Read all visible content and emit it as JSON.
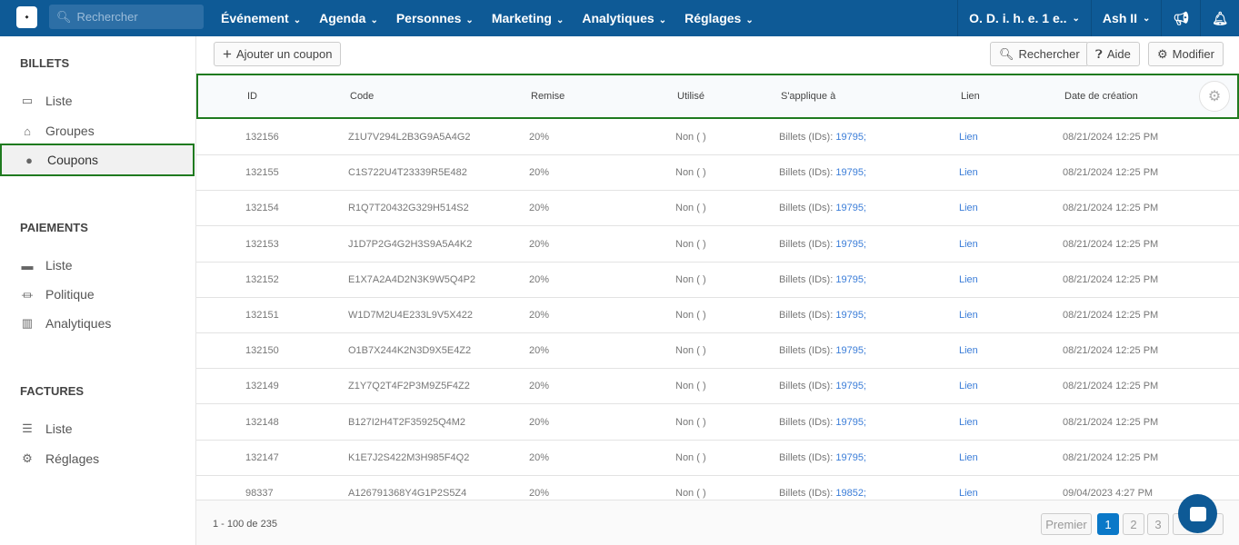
{
  "topbar": {
    "search_placeholder": "Rechercher",
    "nav": [
      "Événement",
      "Agenda",
      "Personnes",
      "Marketing",
      "Analytiques",
      "Réglages"
    ],
    "org": "O. D. i. h. e. 1 e..",
    "user": "Ash II"
  },
  "sidebar": {
    "sections": [
      {
        "title": "BILLETS",
        "items": [
          "Liste",
          "Groupes",
          "Coupons"
        ]
      },
      {
        "title": "PAIEMENTS",
        "items": [
          "Liste",
          "Politique",
          "Analytiques"
        ]
      },
      {
        "title": "FACTURES",
        "items": [
          "Liste",
          "Réglages"
        ]
      }
    ],
    "active": "Coupons"
  },
  "toolbar": {
    "add": "Ajouter un coupon",
    "search": "Rechercher",
    "help": "Aide",
    "edit": "Modifier"
  },
  "table": {
    "headers": [
      "ID",
      "Code",
      "Remise",
      "Utilisé",
      "S'applique à",
      "Lien",
      "Date de création"
    ],
    "rows": [
      [
        "132156",
        "Z1U7V294L2B3G9A5A4G2",
        "20%",
        "Non ( )",
        "Billets (IDs): ",
        "19795;",
        "Lien",
        "08/21/2024 12:25 PM"
      ],
      [
        "132155",
        "C1S722U4T23339R5E482",
        "20%",
        "Non ( )",
        "Billets (IDs): ",
        "19795;",
        "Lien",
        "08/21/2024 12:25 PM"
      ],
      [
        "132154",
        "R1Q7T20432G329H514S2",
        "20%",
        "Non ( )",
        "Billets (IDs): ",
        "19795;",
        "Lien",
        "08/21/2024 12:25 PM"
      ],
      [
        "132153",
        "J1D7P2G4G2H3S9A5A4K2",
        "20%",
        "Non ( )",
        "Billets (IDs): ",
        "19795;",
        "Lien",
        "08/21/2024 12:25 PM"
      ],
      [
        "132152",
        "E1X7A2A4D2N3K9W5Q4P2",
        "20%",
        "Non ( )",
        "Billets (IDs): ",
        "19795;",
        "Lien",
        "08/21/2024 12:25 PM"
      ],
      [
        "132151",
        "W1D7M2U4E233L9V5X422",
        "20%",
        "Non ( )",
        "Billets (IDs): ",
        "19795;",
        "Lien",
        "08/21/2024 12:25 PM"
      ],
      [
        "132150",
        "O1B7X244K2N3D9X5E4Z2",
        "20%",
        "Non ( )",
        "Billets (IDs): ",
        "19795;",
        "Lien",
        "08/21/2024 12:25 PM"
      ],
      [
        "132149",
        "Z1Y7Q2T4F2P3M9Z5F4Z2",
        "20%",
        "Non ( )",
        "Billets (IDs): ",
        "19795;",
        "Lien",
        "08/21/2024 12:25 PM"
      ],
      [
        "132148",
        "B127I2H4T2F35925Q4M2",
        "20%",
        "Non ( )",
        "Billets (IDs): ",
        "19795;",
        "Lien",
        "08/21/2024 12:25 PM"
      ],
      [
        "132147",
        "K1E7J2S422M3H985F4Q2",
        "20%",
        "Non ( )",
        "Billets (IDs): ",
        "19795;",
        "Lien",
        "08/21/2024 12:25 PM"
      ],
      [
        "98337",
        "A126791368Y4G1P2S5Z4",
        "20%",
        "Non ( )",
        "Billets (IDs): ",
        "19852;",
        "Lien",
        "09/04/2023 4:27 PM"
      ]
    ]
  },
  "footer": {
    "count": "1 - 100 de 235",
    "pages": [
      "Premier",
      "1",
      "2",
      "3"
    ],
    "current": "1"
  },
  "colors": {
    "topbar": "#0e5a96",
    "highlight": "#1f7a1f",
    "link": "#3b7dd8",
    "active_page": "#0a78c8"
  }
}
